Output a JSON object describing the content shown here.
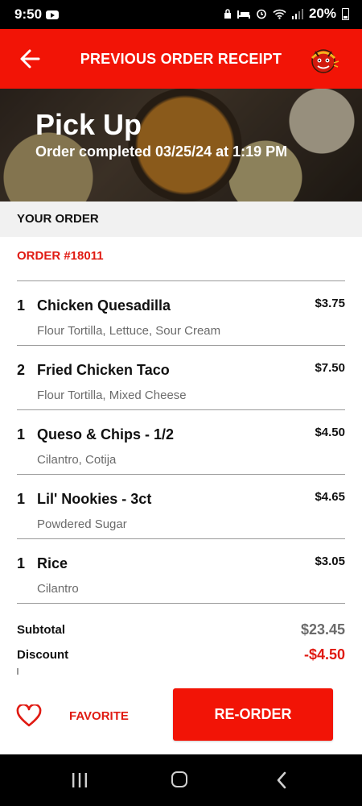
{
  "status_bar": {
    "time": "9:50",
    "battery": "20%",
    "icons": [
      "youtube-icon",
      "lock-icon",
      "sleep-icon",
      "alarm-icon",
      "wifi-icon",
      "signal-icon",
      "battery-icon"
    ]
  },
  "header": {
    "title": "PREVIOUS ORDER RECEIPT"
  },
  "hero": {
    "title": "Pick Up",
    "subtitle": "Order completed 03/25/24 at 1:19 PM"
  },
  "section": {
    "your_order_label": "YOUR ORDER",
    "order_number": "ORDER #18011"
  },
  "items": [
    {
      "qty": "1",
      "name": "Chicken Quesadilla",
      "price": "$3.75",
      "mods": "Flour Tortilla, Lettuce, Sour Cream"
    },
    {
      "qty": "2",
      "name": "Fried Chicken Taco",
      "price": "$7.50",
      "mods": "Flour Tortilla, Mixed Cheese"
    },
    {
      "qty": "1",
      "name": "Queso & Chips - 1/2",
      "price": "$4.50",
      "mods": "Cilantro, Cotija"
    },
    {
      "qty": "1",
      "name": "Lil' Nookies - 3ct",
      "price": "$4.65",
      "mods": "Powdered Sugar"
    },
    {
      "qty": "1",
      "name": "Rice",
      "price": "$3.05",
      "mods": "Cilantro"
    }
  ],
  "totals": {
    "subtotal_label": "Subtotal",
    "subtotal_value": "$23.45",
    "discount_label": "Discount",
    "discount_value": "-$4.50"
  },
  "actions": {
    "favorite_label": "FAVORITE",
    "reorder_label": "RE-ORDER"
  },
  "colors": {
    "brand_red": "#f21406",
    "accent_red_text": "#e01a12",
    "muted_gray": "#6b6b6b"
  }
}
